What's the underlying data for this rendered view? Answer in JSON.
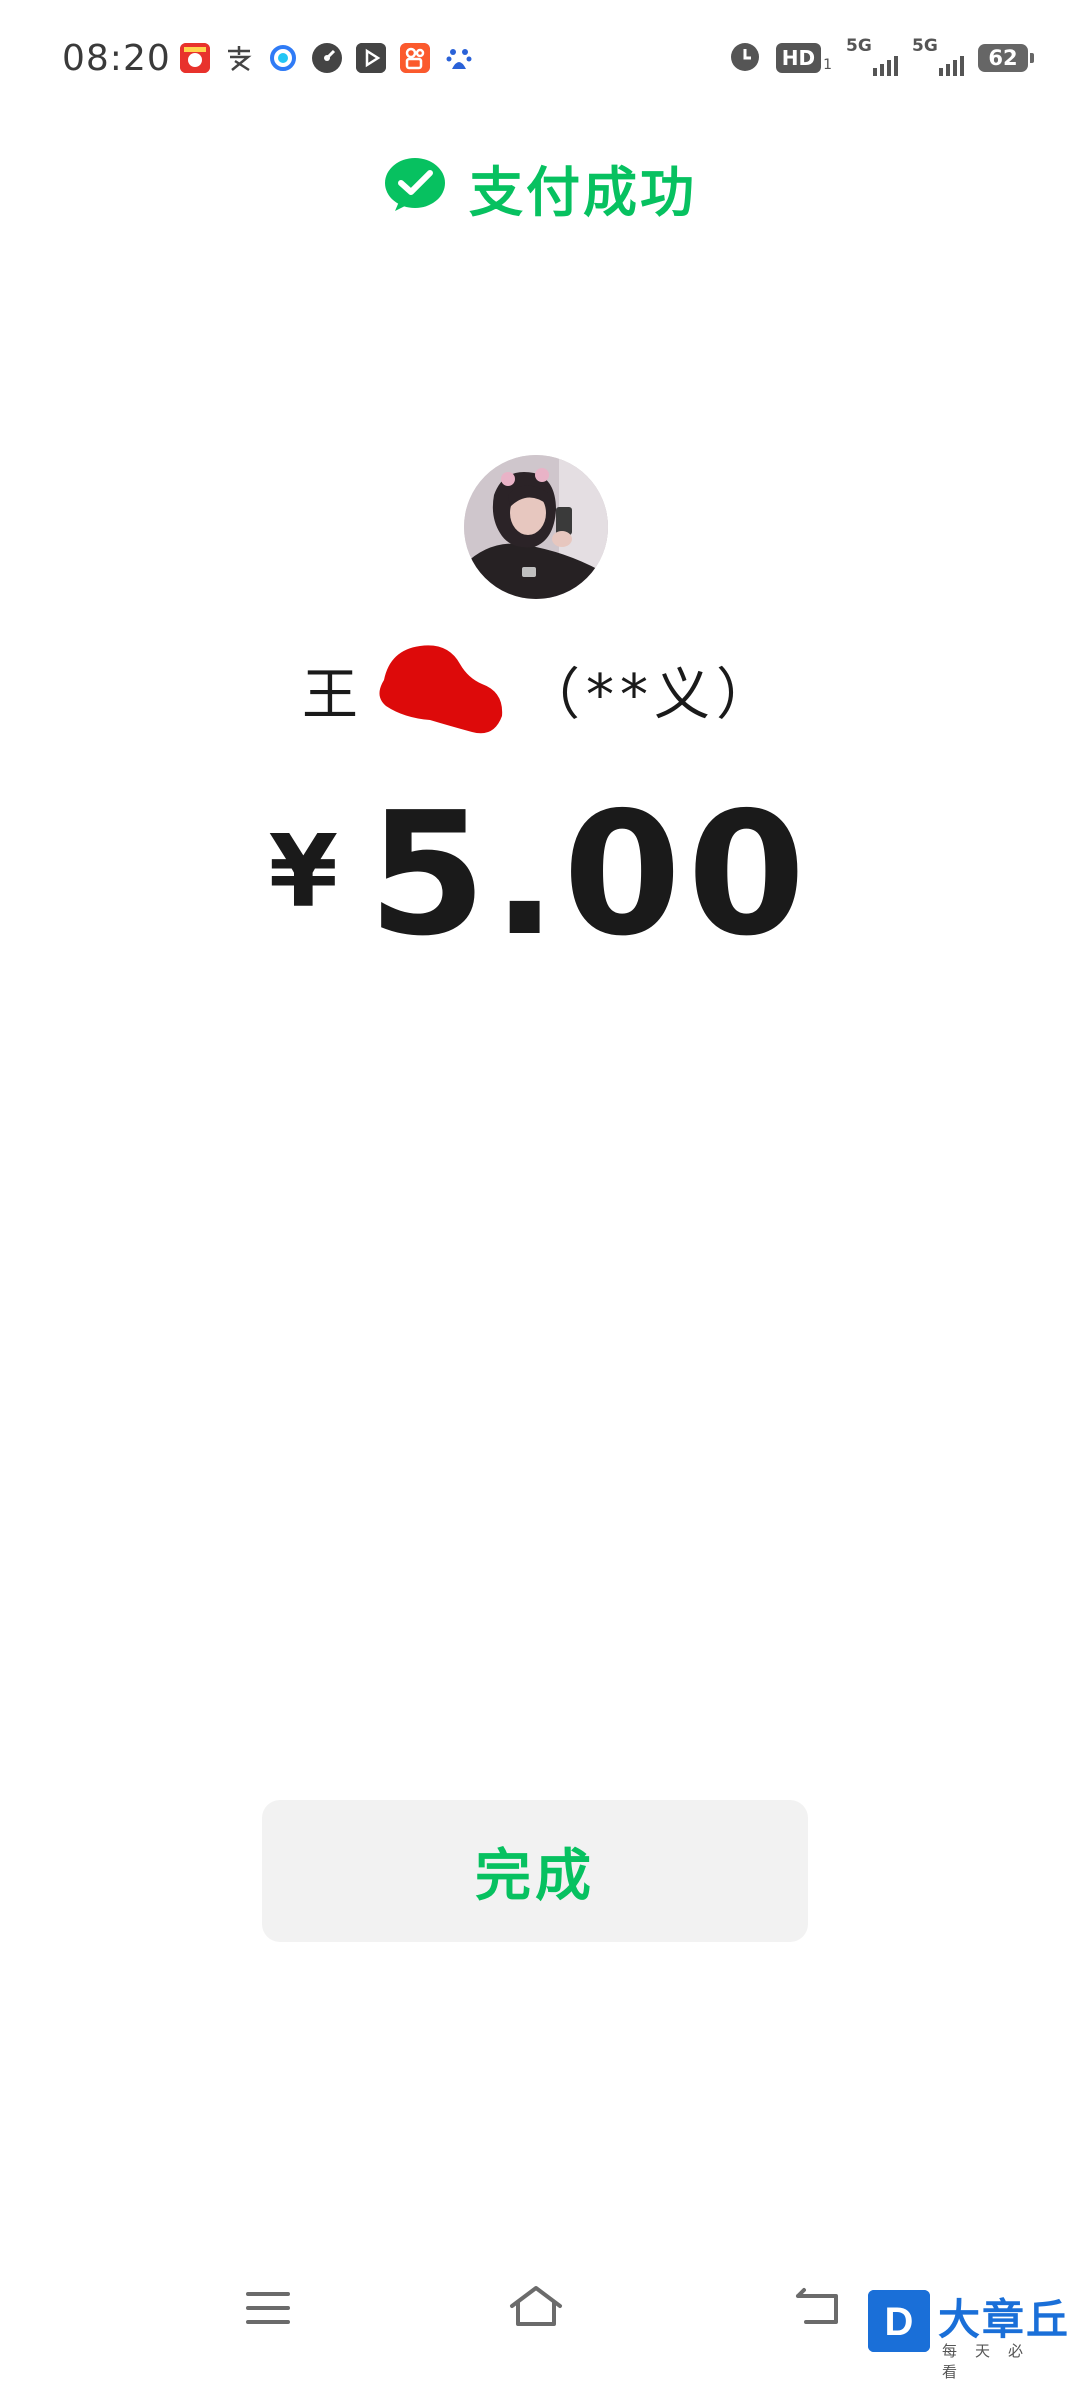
{
  "status_bar": {
    "time": "08:20",
    "notification_icons": [
      "app-icon-red-badge",
      "alipay-icon",
      "quark-browser-icon",
      "speed-icon",
      "video-icon",
      "kuaishou-icon",
      "baidu-icon"
    ],
    "alarm": "alarm-icon",
    "hd_label": "HD",
    "hd_sub": "1",
    "sim1_network": "5G",
    "sim2_network": "5G",
    "battery": "62"
  },
  "header": {
    "title": "支付成功",
    "icon": "wechat-pay-check-icon",
    "accent_color": "#07c160"
  },
  "payee": {
    "avatar": "payee-avatar",
    "name_prefix": "王",
    "name_masked": "（**义）"
  },
  "payment": {
    "currency_symbol": "¥",
    "amount": "5.00"
  },
  "actions": {
    "done_label": "完成"
  },
  "nav": {
    "menu": "menu-icon",
    "home": "home-icon",
    "back": "back-icon"
  },
  "watermark": {
    "logo_letter": "D",
    "brand": "大章丘",
    "tagline": "每天必看"
  }
}
